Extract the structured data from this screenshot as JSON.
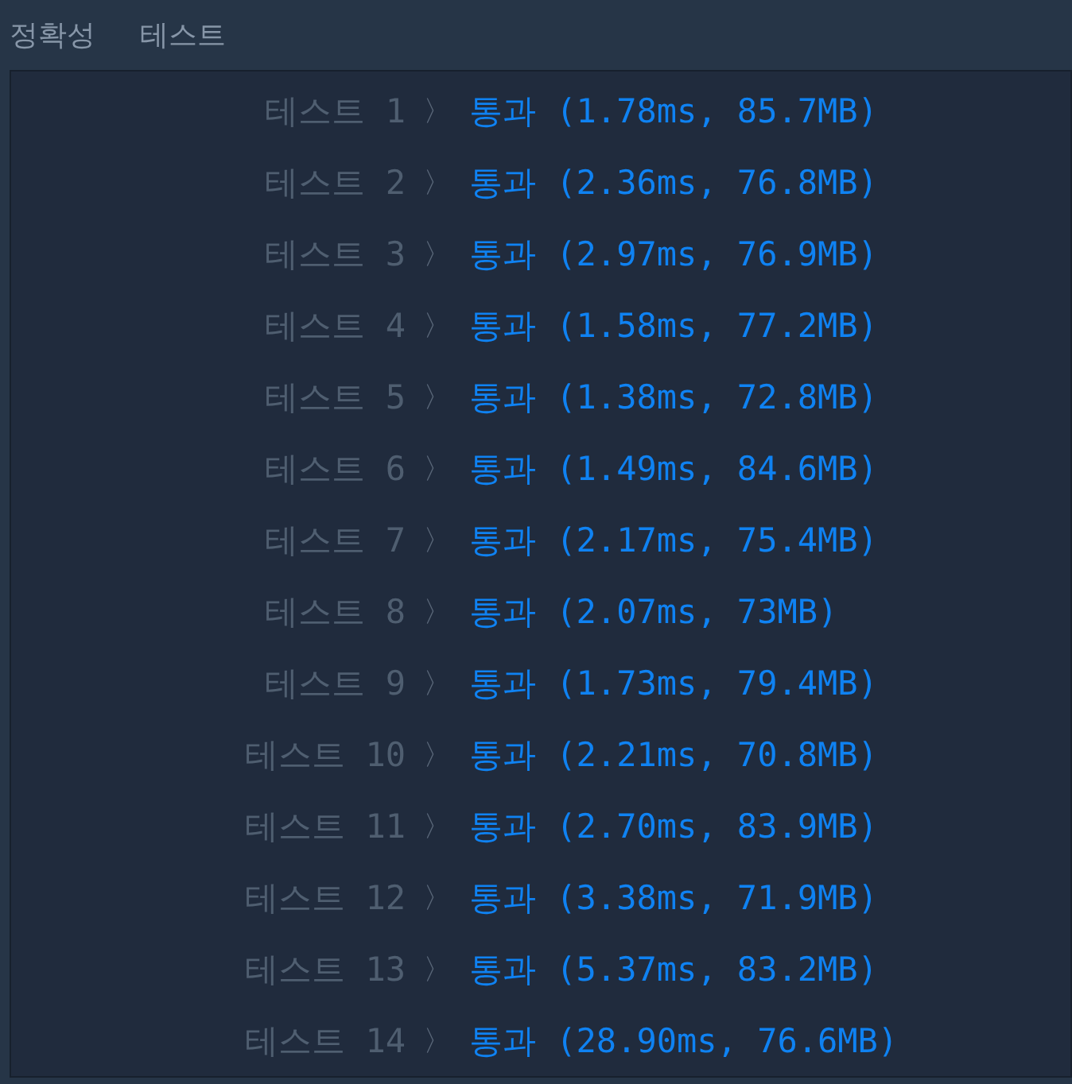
{
  "header": {
    "labels": [
      "정확성",
      "테스트"
    ]
  },
  "results": [
    {
      "label": "테스트 1",
      "separator": "〉",
      "result": "통과 (1.78ms, 85.7MB)"
    },
    {
      "label": "테스트 2",
      "separator": "〉",
      "result": "통과 (2.36ms, 76.8MB)"
    },
    {
      "label": "테스트 3",
      "separator": "〉",
      "result": "통과 (2.97ms, 76.9MB)"
    },
    {
      "label": "테스트 4",
      "separator": "〉",
      "result": "통과 (1.58ms, 77.2MB)"
    },
    {
      "label": "테스트 5",
      "separator": "〉",
      "result": "통과 (1.38ms, 72.8MB)"
    },
    {
      "label": "테스트 6",
      "separator": "〉",
      "result": "통과 (1.49ms, 84.6MB)"
    },
    {
      "label": "테스트 7",
      "separator": "〉",
      "result": "통과 (2.17ms, 75.4MB)"
    },
    {
      "label": "테스트 8",
      "separator": "〉",
      "result": "통과 (2.07ms, 73MB)"
    },
    {
      "label": "테스트 9",
      "separator": "〉",
      "result": "통과 (1.73ms, 79.4MB)"
    },
    {
      "label": "테스트 10",
      "separator": "〉",
      "result": "통과 (2.21ms, 70.8MB)"
    },
    {
      "label": "테스트 11",
      "separator": "〉",
      "result": "통과 (2.70ms, 83.9MB)"
    },
    {
      "label": "테스트 12",
      "separator": "〉",
      "result": "통과 (3.38ms, 71.9MB)"
    },
    {
      "label": "테스트 13",
      "separator": "〉",
      "result": "통과 (5.37ms, 83.2MB)"
    },
    {
      "label": "테스트 14",
      "separator": "〉",
      "result": "통과 (28.90ms, 76.6MB)"
    }
  ]
}
